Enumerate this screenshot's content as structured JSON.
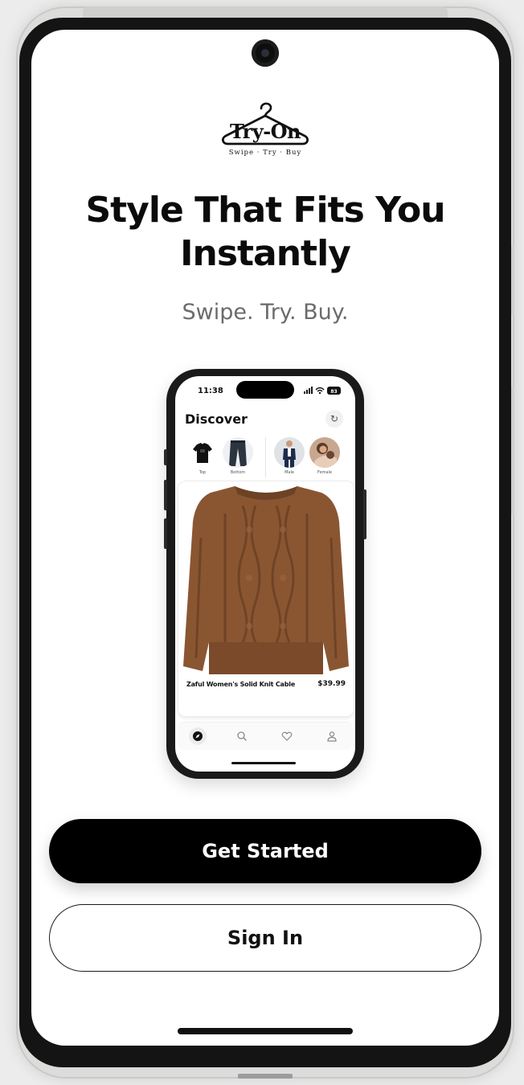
{
  "logo": {
    "word": "Try-On",
    "tagline": "Swipe · Try · Buy",
    "icon": "hanger-icon"
  },
  "headline": {
    "line1": "Style That Fits You",
    "line2": "Instantly"
  },
  "subheadline": "Swipe. Try. Buy.",
  "mockup": {
    "status": {
      "time": "11:38",
      "battery": "83"
    },
    "title": "Discover",
    "refresh_icon": "refresh-icon",
    "categories": [
      {
        "label": "Top",
        "icon": "tshirt-icon"
      },
      {
        "label": "Bottom",
        "icon": "pants-icon"
      },
      {
        "label": "Male",
        "icon": "male-model-icon"
      },
      {
        "label": "Female",
        "icon": "female-model-icon"
      }
    ],
    "product": {
      "name": "Zaful Women's Solid Knit Cable",
      "price": "$39.99",
      "image": "brown-knit-sweater"
    },
    "tabs": [
      {
        "icon": "compass-icon",
        "active": true
      },
      {
        "icon": "search-icon",
        "active": false
      },
      {
        "icon": "heart-icon",
        "active": false
      },
      {
        "icon": "profile-icon",
        "active": false
      }
    ]
  },
  "actions": {
    "primary_label": "Get Started",
    "secondary_label": "Sign In"
  },
  "colors": {
    "primary_button": "#000000",
    "text": "#0b0b0b",
    "subtext": "#6b6b6b",
    "sweater": "#8a5632"
  }
}
